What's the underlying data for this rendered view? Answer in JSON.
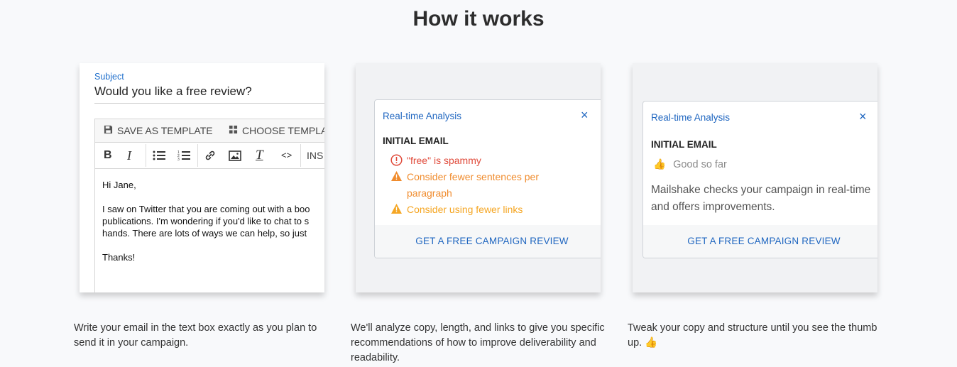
{
  "page": {
    "title": "How it works"
  },
  "colors": {
    "accent": "#1f66c0",
    "error": "#e04a3a",
    "warning": "#f5a623"
  },
  "editor": {
    "subject_label": "Subject",
    "subject_value": "Would you like a free review?",
    "save_template": "SAVE AS TEMPLATE",
    "choose_template": "CHOOSE TEMPLA",
    "insert_label": "INS",
    "body_lines": [
      "Hi Jane,",
      "",
      "I saw on Twitter that you are coming out with a boo",
      "publications. I'm wondering if you'd like to chat to s",
      "hands. There are lots of ways we can help, so just",
      "",
      "Thanks!"
    ]
  },
  "analysis_bad": {
    "title": "Real-time Analysis",
    "close": "×",
    "heading": "INITIAL EMAIL",
    "issues": [
      {
        "level": "error",
        "icon": "alert-circle-icon",
        "lines": [
          "\"free\" is spammy"
        ]
      },
      {
        "level": "warning",
        "icon": "warning-triangle-icon",
        "lines": [
          "Consider fewer sentences per",
          "paragraph"
        ]
      },
      {
        "level": "warning",
        "icon": "warning-triangle-icon",
        "lines": [
          "Consider using fewer links"
        ]
      }
    ],
    "cta": "GET A FREE CAMPAIGN REVIEW"
  },
  "analysis_good": {
    "title": "Real-time Analysis",
    "close": "×",
    "heading": "INITIAL EMAIL",
    "status_icon": "thumbs-up-icon",
    "status": "Good so far",
    "description": "Mailshake checks your campaign in real-time and offers improvements.",
    "cta": "GET A FREE CAMPAIGN REVIEW"
  },
  "steps": [
    {
      "caption": "Write your email in the text box exactly as you plan to send it in your campaign."
    },
    {
      "caption": "We'll analyze copy, length, and links to give you specific recommendations of how to improve deliverability and readability."
    },
    {
      "caption": "Tweak your copy and structure until you see the thumb up.",
      "emoji": "👍"
    }
  ]
}
